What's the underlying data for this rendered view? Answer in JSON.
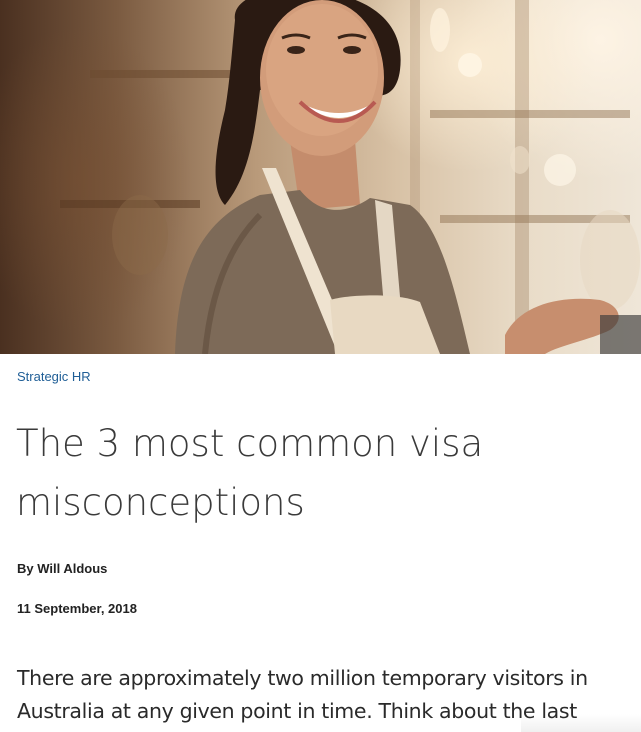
{
  "hero": {
    "image_name": "hero-photo"
  },
  "article": {
    "category": "Strategic HR",
    "title": "The 3 most common visa misconceptions",
    "byline": "By Will Aldous",
    "date": "11 September, 2018",
    "lead": "There are approximately two million temporary visitors in Australia at any given point in time. Think about the last"
  },
  "colors": {
    "category_link": "#1f5e96",
    "title": "#3a3a3a",
    "body": "#2a2a2a"
  }
}
